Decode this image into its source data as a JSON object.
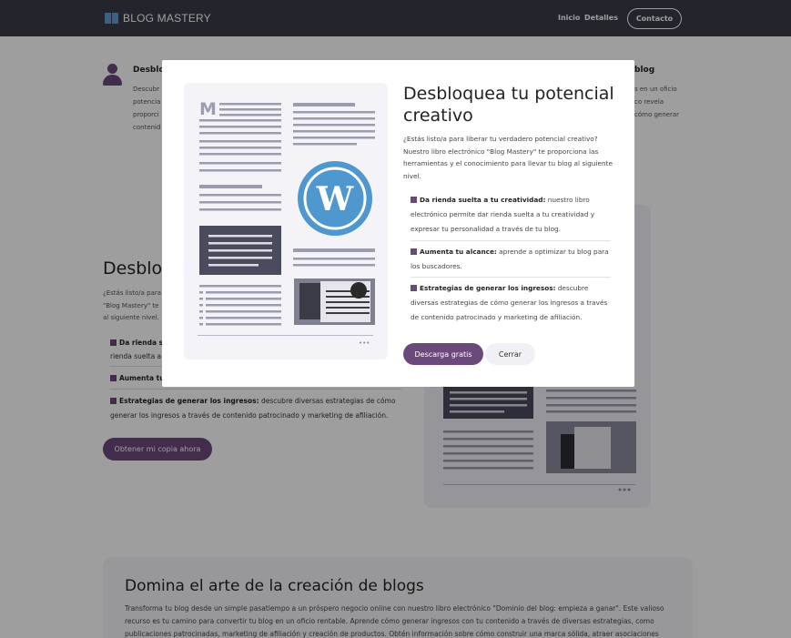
{
  "nav": {
    "brand": "BLOG MASTERY",
    "links": [
      "Inicio",
      "Detalles"
    ],
    "contact": "Contacto"
  },
  "features": {
    "left_title": "Desblo",
    "left_text": [
      "Descubr",
      "potencia",
      "proporci",
      "contenid"
    ],
    "right_title": "blog",
    "right_text": [
      "s en un oficio",
      "co revela",
      "cómo generar"
    ]
  },
  "hero": {
    "title": "Desblo",
    "paragraph": [
      "¿Estás listo/a para",
      "\"Blog Mastery\" te",
      "al siguiente nivel."
    ],
    "items": [
      {
        "bold": "Da rienda s",
        "text": "",
        "cont": "rienda suelta a"
      },
      {
        "bold": "Aumenta tu",
        "text": ""
      },
      {
        "bold": "Estrategias de generar los ingresos:",
        "text": " descubre diversas estrategias de cómo",
        "cont": "generar los ingresos a través de contenido patrocinado y marketing de afiliación."
      }
    ],
    "cta": "Obtener mi copia ahora"
  },
  "mastery": {
    "title": "Domina el arte de la creación de blogs",
    "paragraph": [
      "Transforma tu blog desde un simple pasatiempo a un próspero negocio online con nuestro libro electrónico \"Dominio del blog: empieza a ganar\". Este valioso",
      "recurso es tu camino para convertir tu blog en un oficio rentable. Aprende cómo generar ingresos con tu contenido a través de diversas estrategias, como",
      "publicaciones patrocinadas, marketing de afiliación y creación de productos. Obtén información sobre cómo construir una marca sólida, atraer asociaciones"
    ]
  },
  "modal": {
    "title": "Desbloquea tu potencial creativo",
    "paragraph": "¿Estás listo/a para liberar tu verdadero potencial creativo? Nuestro libro electrónico \"Blog Mastery\" te proporciona las herramientas y el conocimiento para llevar tu blog al siguiente nivel.",
    "items": [
      {
        "bold": "Da rienda suelta a tu creatividad:",
        "text": " nuestro libro electrónico permite dar rienda suelta a tu creatividad y expresar tu personalidad a través de tu blog."
      },
      {
        "bold": "Aumenta tu alcance:",
        "text": " aprende a optimizar tu blog para los buscadores."
      },
      {
        "bold": "Estrategias de generar los ingresos:",
        "text": " descubre diversas estrategias de cómo generar los ingresos a través de contenido patrocinado y marketing de afiliación."
      }
    ],
    "primary": "Descarga gratis",
    "secondary": "Cerrar",
    "illustration_letter": "M",
    "ellipsis": "•••"
  },
  "colors": {
    "nav_bg": "#3a3b4a",
    "accent": "#6b4a7b",
    "wp_blue": "#4f98cf",
    "doc_lines": "#9b9caf",
    "dark_block": "#4a4b5c"
  }
}
